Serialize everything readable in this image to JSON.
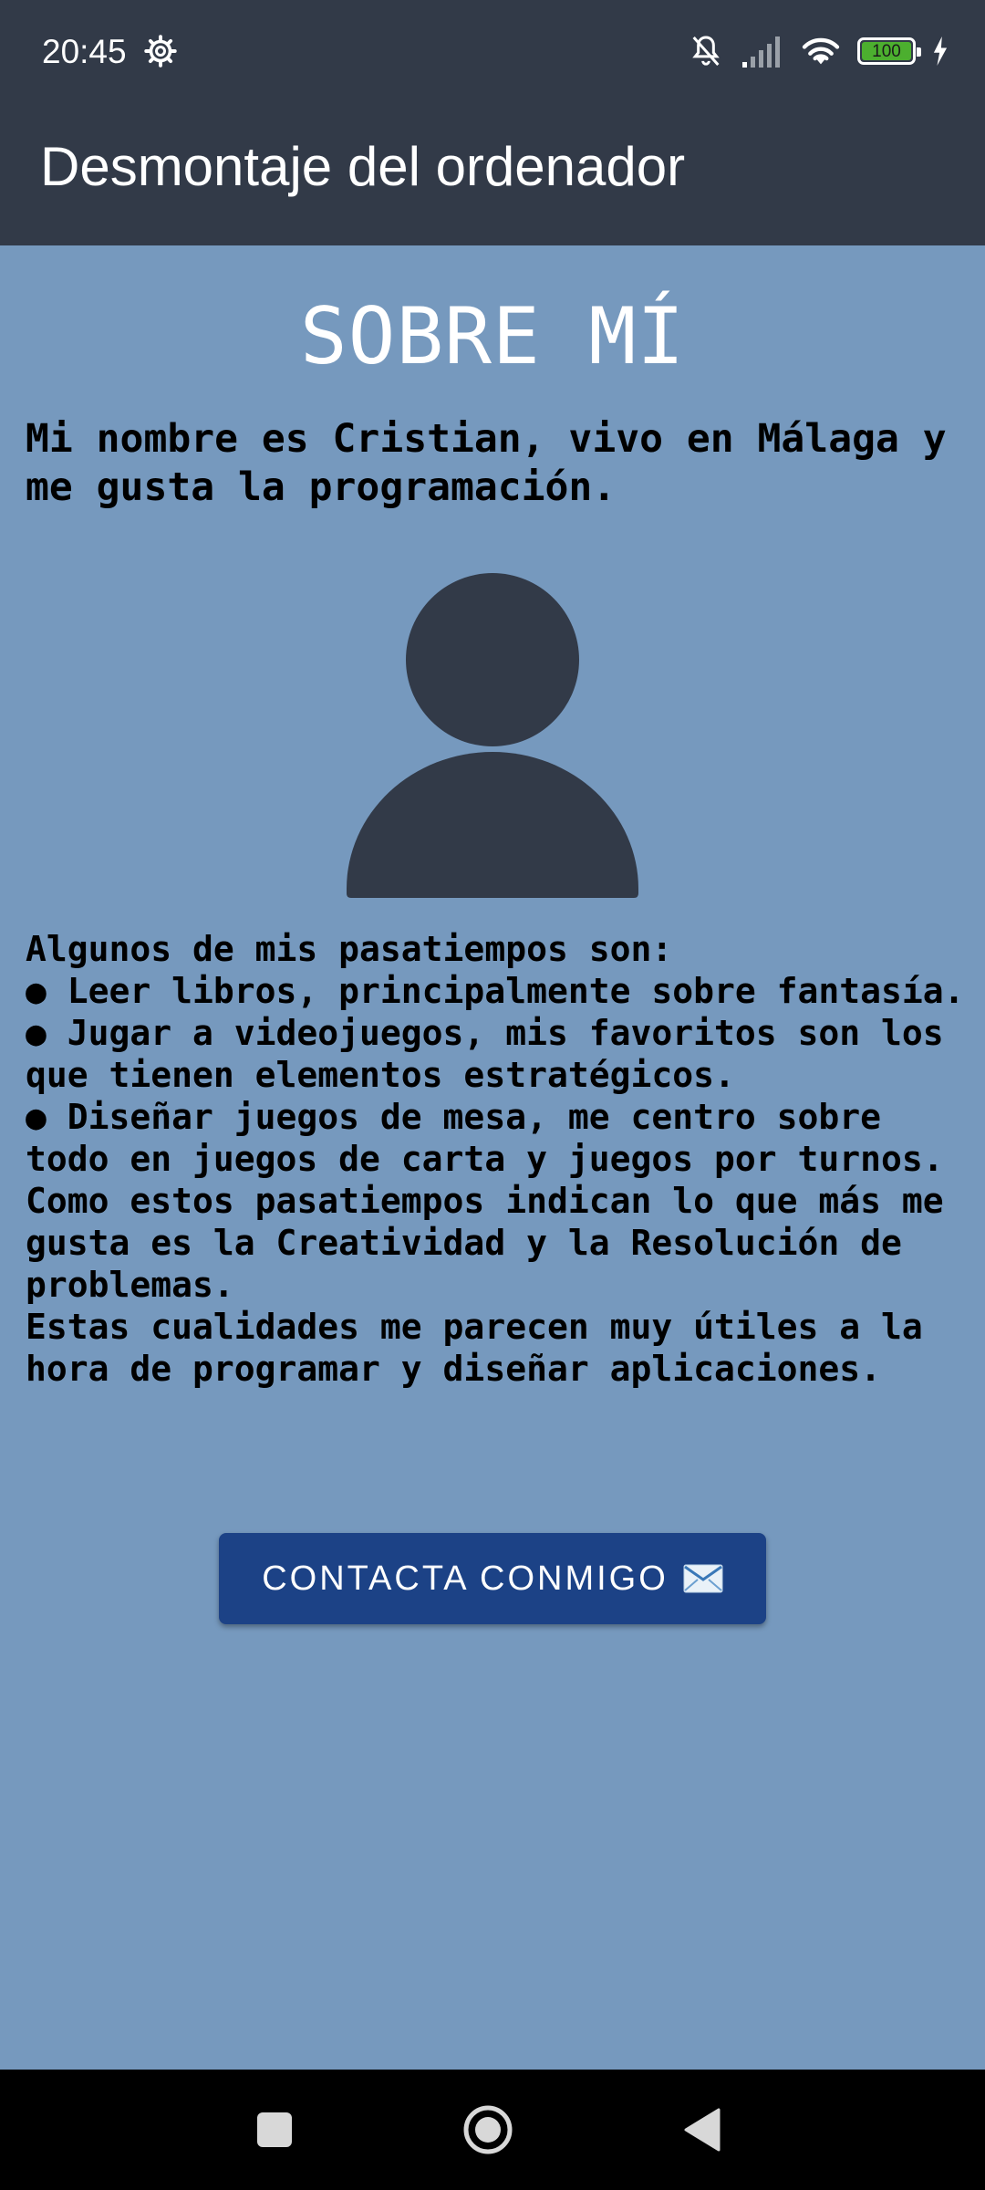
{
  "status_bar": {
    "time": "20:45",
    "battery_level": "100",
    "icons": [
      "gear-icon",
      "bell-off-icon",
      "signal-icon",
      "wifi-icon",
      "battery-icon",
      "charging-icon"
    ]
  },
  "app_bar": {
    "title": "Desmontaje del ordenador"
  },
  "content": {
    "title": "SOBRE MÍ",
    "intro": "Mi nombre es Cristian, vivo en Málaga y me gusta la programación.",
    "hobbies_text": "Algunos de mis pasatiempos son:\n● Leer libros, principalmente sobre fantasía.\n● Jugar a videojuegos, mis favoritos son los que tienen elementos estratégicos.\n● Diseñar juegos de mesa, me centro sobre todo en juegos de carta y juegos por turnos.\nComo estos pasatiempos indican lo que más me gusta es la Creatividad y la Resolución de problemas.\nEstas cualidades me parecen muy útiles a la hora de programar y diseñar aplicaciones.",
    "contact_button_label": "CONTACTA CONMIGO"
  },
  "nav_bar": {
    "buttons": [
      "recents-button",
      "home-button",
      "back-button"
    ]
  },
  "colors": {
    "background": "#7699be",
    "app_bar": "#323a48",
    "button": "#1c4286",
    "avatar": "#323a48"
  }
}
